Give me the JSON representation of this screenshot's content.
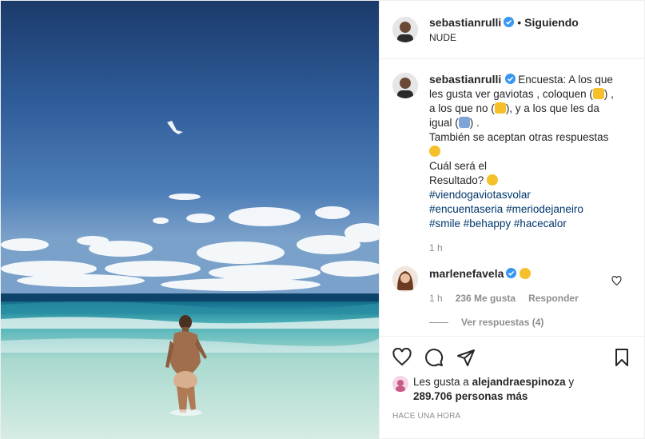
{
  "header": {
    "username": "sebastianrulli",
    "separator": "•",
    "follow_state": "Siguiendo",
    "location": "NUDE"
  },
  "caption": {
    "username": "sebastianrulli",
    "text_1": "Encuesta: A los que les gusta ver gaviotas , coloquen (",
    "text_2": ") , a los que no (",
    "text_3": "), y a los que les da igual (",
    "text_4": ") .",
    "line_2": "También se aceptan otras respuestas",
    "line_3": "Cuál será el",
    "line_4": "Resultado?",
    "hashtags": [
      "#viendogaviotasvolar",
      "#encuentaseria",
      "#meriodejaneiro",
      "#smile",
      "#behappy",
      "#hacecalor"
    ],
    "time": "1 h",
    "emoji_names": [
      "thumbs-up",
      "thumbs-down",
      "shrug",
      "laughing-face",
      "thinking-face"
    ]
  },
  "comment": {
    "username": "marlenefavela",
    "emoji": "screaming-face",
    "time": "1 h",
    "likes": "236 Me gusta",
    "reply": "Responder",
    "view_replies": "Ver respuestas (4)"
  },
  "likes": {
    "prefix": "Les gusta a",
    "user": "alejandraespinoza",
    "conj": "y",
    "others": "289.706 personas más"
  },
  "posted_time": "HACE UNA HORA",
  "colors": {
    "text": "#262626",
    "muted": "#8e8e8e",
    "verified": "#3897f0",
    "hashtag": "#00376b",
    "border": "#efefef"
  }
}
